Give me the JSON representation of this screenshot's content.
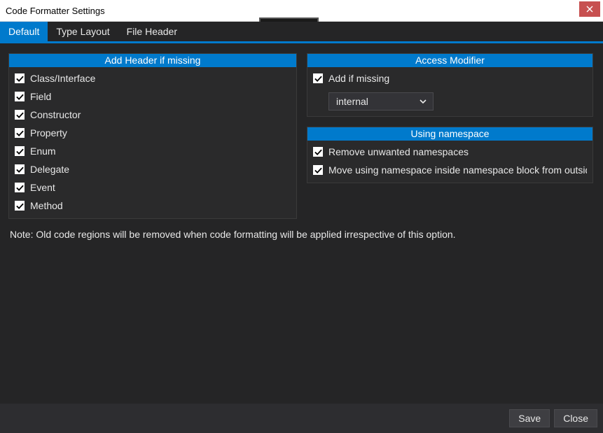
{
  "window": {
    "title": "Code Formatter Settings"
  },
  "tabs": [
    {
      "label": "Default",
      "active": true
    },
    {
      "label": "Type Layout",
      "active": false
    },
    {
      "label": "File Header",
      "active": false
    }
  ],
  "panels": {
    "addHeader": {
      "title": "Add Header if missing",
      "items": [
        {
          "label": "Class/Interface",
          "checked": true
        },
        {
          "label": "Field",
          "checked": true
        },
        {
          "label": "Constructor",
          "checked": true
        },
        {
          "label": "Property",
          "checked": true
        },
        {
          "label": "Enum",
          "checked": true
        },
        {
          "label": "Delegate",
          "checked": true
        },
        {
          "label": "Event",
          "checked": true
        },
        {
          "label": "Method",
          "checked": true
        }
      ]
    },
    "accessModifier": {
      "title": "Access Modifier",
      "addIfMissing": {
        "label": "Add if missing",
        "checked": true
      },
      "selectValue": "internal"
    },
    "usingNamespace": {
      "title": "Using namespace",
      "items": [
        {
          "label": "Remove unwanted namespaces",
          "checked": true
        },
        {
          "label": "Move using namespace inside namespace block from outside",
          "checked": true
        }
      ]
    }
  },
  "note": "Note: Old code regions will be removed when code formatting will be applied irrespective of this option.",
  "footer": {
    "save": "Save",
    "close": "Close"
  }
}
